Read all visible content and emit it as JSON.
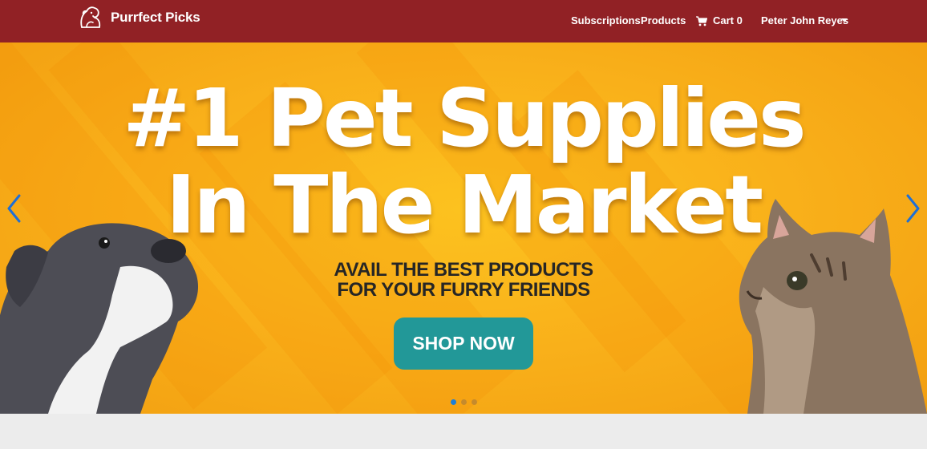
{
  "brand": {
    "name": "Purrfect Picks",
    "logo_icon": "pet-logo-icon"
  },
  "nav": {
    "subscriptions": "Subscriptions",
    "products": "Products",
    "cart_label": "Cart 0",
    "cart_icon": "cart-icon",
    "user_name": "Peter John Reyes",
    "user_menu_icon": "caret-down-icon"
  },
  "hero": {
    "headline_line1": "#1 Pet Supplies",
    "headline_line2": "In The Market",
    "subline_line1": "AVAIL THE BEST PRODUCTS",
    "subline_line2": "FOR YOUR FURRY FRIENDS",
    "cta_label": "SHOP NOW",
    "slides_total": 3,
    "active_slide": 1
  },
  "colors": {
    "navbar": "#912125",
    "hero_bg": "#f9b01a",
    "cta": "#229898",
    "arrow": "#1e6fd6",
    "dot_active": "#1e7fd6"
  }
}
